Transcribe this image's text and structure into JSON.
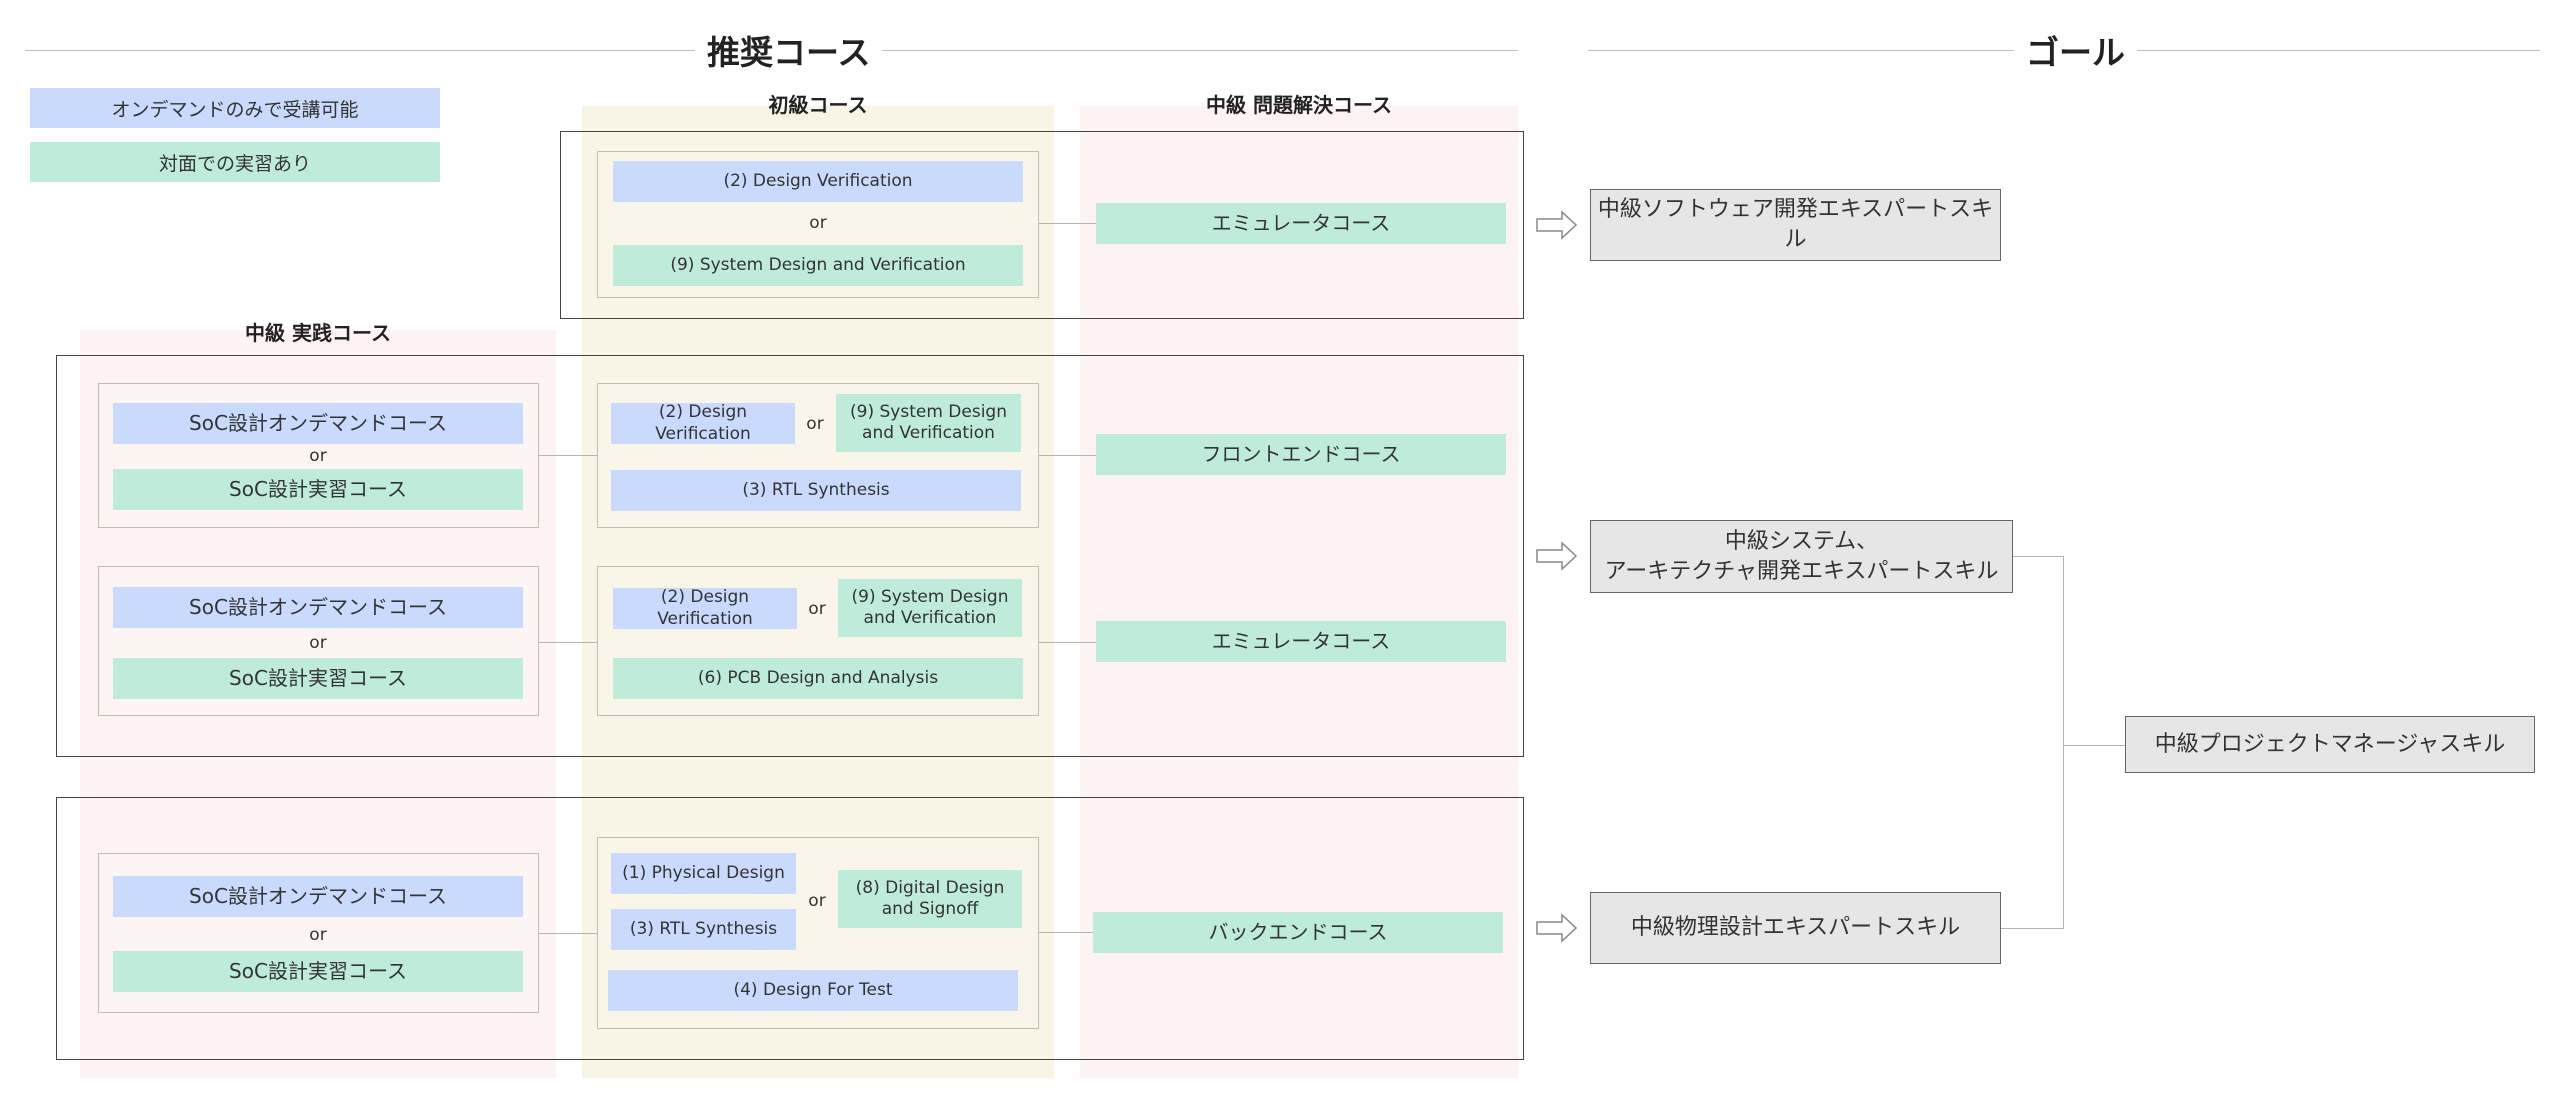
{
  "headers": {
    "recommended": "推奨コース",
    "goal": "ゴール"
  },
  "legend": {
    "ondemand": "オンデマンドのみで受講可能",
    "inperson": "対面での実習あり"
  },
  "columns": {
    "beginner": "初級コース",
    "problem_solving": "中級 問題解決コース",
    "practice": "中級 実践コース"
  },
  "or": "or",
  "group1": {
    "beginner": {
      "a": "(2) Design Verification",
      "b": "(9) System Design and Verification"
    },
    "problem": "エミュレータコース"
  },
  "group2": {
    "row1": {
      "practice": {
        "a": "SoC設計オンデマンドコース",
        "b": "SoC設計実習コース"
      },
      "beginner": {
        "a": "(2) Design Verification",
        "b": "(9) System Design and Verification",
        "c": "(3) RTL Synthesis"
      },
      "problem": "フロントエンドコース"
    },
    "row2": {
      "practice": {
        "a": "SoC設計オンデマンドコース",
        "b": "SoC設計実習コース"
      },
      "beginner": {
        "a": "(2) Design Verification",
        "b": "(9) System Design and Verification",
        "c": "(6) PCB Design and Analysis"
      },
      "problem": "エミュレータコース"
    }
  },
  "group3": {
    "practice": {
      "a": "SoC設計オンデマンドコース",
      "b": "SoC設計実習コース"
    },
    "beginner": {
      "a": "(1) Physical Design",
      "b": "(3) RTL Synthesis",
      "c": "(8) Digital Design and Signoff",
      "d": "(4) Design For Test"
    },
    "problem": "バックエンドコース"
  },
  "goals": {
    "software": "中級ソフトウェア開発エキスパートスキル",
    "system_line1": "中級システム、",
    "system_line2": "アーキテクチャ開発エキスパートスキル",
    "physical": "中級物理設計エキスパートスキル",
    "pm": "中級プロジェクトマネージャスキル"
  },
  "colors": {
    "ondemand": "#c9dafd",
    "inperson": "#bfebdb",
    "beginner_band": "#f8f4e6",
    "intermediate_band": "#fdf3f2",
    "goal_box": "#e6e6e6"
  }
}
